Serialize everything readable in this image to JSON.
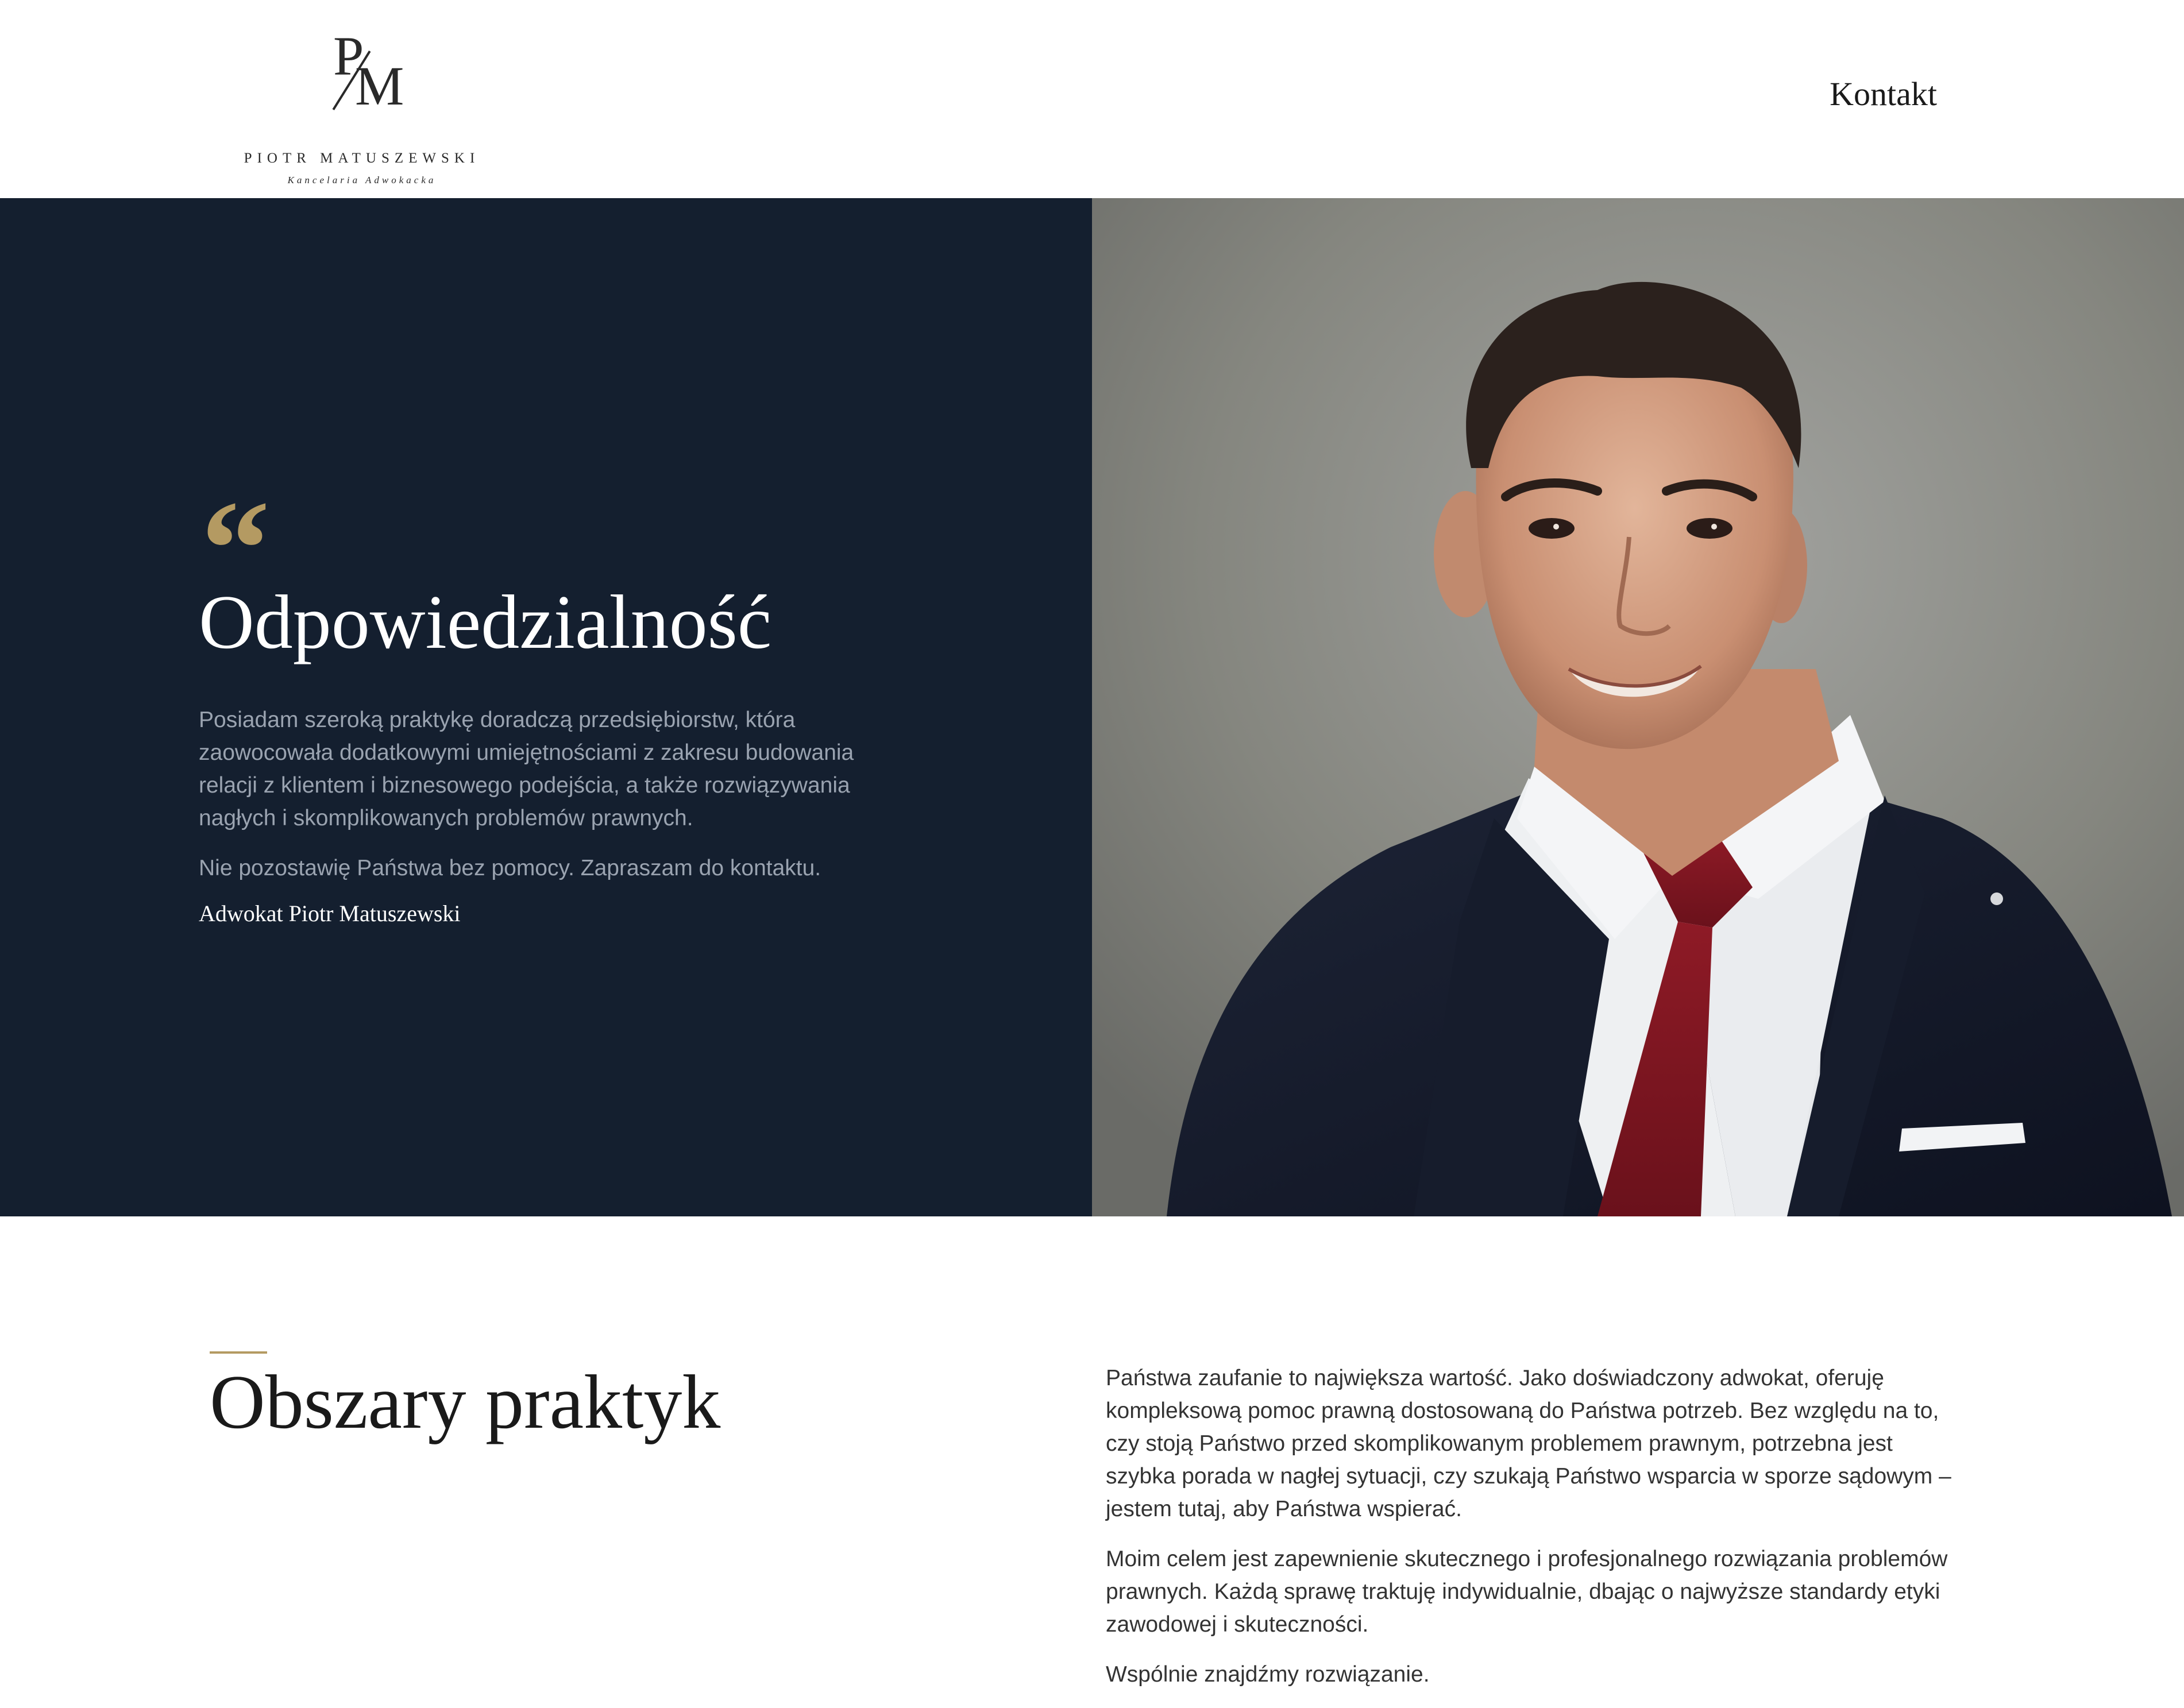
{
  "header": {
    "logo": {
      "monogram_p": "P",
      "monogram_m": "M",
      "name": "PIOTR MATUSZEWSKI",
      "subtitle": "Kancelaria Adwokacka"
    },
    "nav": {
      "contact_label": "Kontakt"
    }
  },
  "hero": {
    "quote_mark": "“",
    "title": "Odpowiedzialność",
    "paragraphs": [
      "Posiadam szeroką praktykę doradczą przedsiębiorstw, która zaowocowała dodatkowymi umiejętnościami z zakresu budowania relacji z klientem i biznesowego podejścia, a także rozwiązywania nagłych i skomplikowanych problemów prawnych.",
      "Nie pozostawię Państwa bez pomocy. Zapraszam do kontaktu."
    ],
    "signature": "Adwokat Piotr Matuszewski"
  },
  "practice": {
    "title": "Obszary praktyk",
    "paragraphs": [
      "Państwa zaufanie to największa wartość. Jako doświadczony adwokat, oferuję kompleksową pomoc prawną dostosowaną do Państwa potrzeb. Bez względu na to, czy stoją Państwo przed skomplikowanym problemem prawnym, potrzebna jest szybka porada w nagłej sytuacji, czy szukają Państwo wsparcia w sporze sądowym – jestem tutaj, aby Państwa wspierać.",
      "Moim celem jest zapewnienie skutecznego i profesjonalnego rozwiązania problemów prawnych. Każdą sprawę traktuję indywidualnie, dbając o najwyższe standardy etyki zawodowej i skuteczności.",
      "Wspólnie znajdźmy rozwiązanie."
    ]
  },
  "colors": {
    "navy": "#141f2f",
    "gold": "#b49a62",
    "tie": "#7d1620"
  }
}
